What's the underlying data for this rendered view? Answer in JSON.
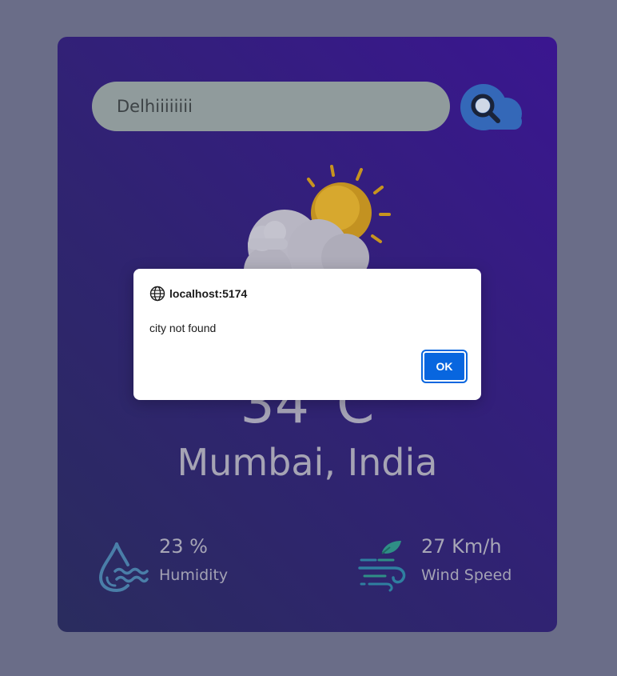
{
  "search": {
    "value": "Delhiiiiiiii"
  },
  "weather": {
    "icon": "sun-behind-cloud-icon",
    "temperature": "34°C",
    "city": "Mumbai, India"
  },
  "stats": {
    "humidity": {
      "value": "23 %",
      "label": "Humidity",
      "icon": "humidity-drop-icon"
    },
    "wind": {
      "value": "27 Km/h",
      "label": "Wind Speed",
      "icon": "wind-icon"
    }
  },
  "dialog": {
    "origin": "localhost:5174",
    "message": "city not found",
    "ok_label": "OK"
  },
  "colors": {
    "overlay": "#6a6d88",
    "card_gradient_start": "#2a2c5e",
    "card_gradient_end": "#3a1690",
    "ok_button": "#0866df"
  }
}
